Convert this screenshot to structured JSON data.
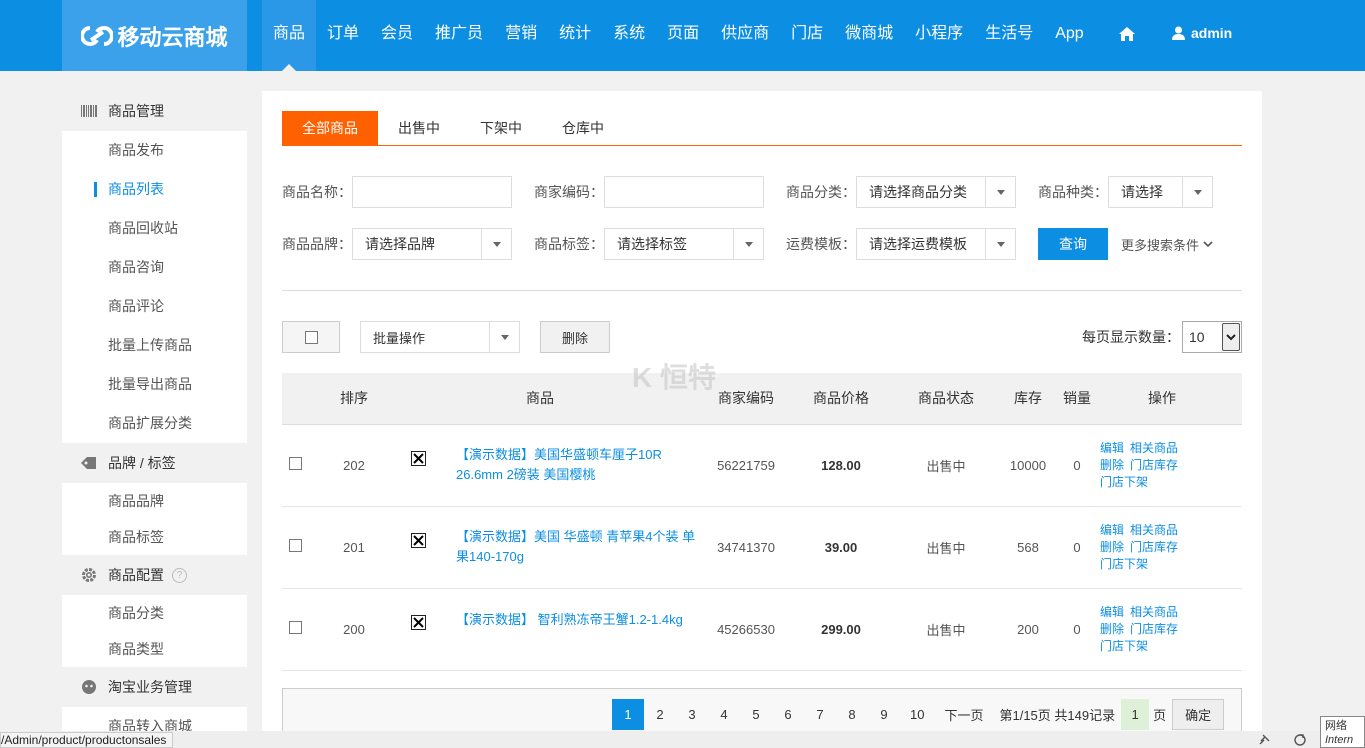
{
  "header": {
    "logo_text": "移动云商城",
    "nav": [
      "商品",
      "订单",
      "会员",
      "推广员",
      "营销",
      "统计",
      "系统",
      "页面",
      "供应商",
      "门店",
      "微商城",
      "小程序",
      "生活号",
      "App"
    ],
    "user": "admin"
  },
  "sidebar": {
    "groups": [
      {
        "title": "商品管理",
        "icon": "barcode-icon",
        "items": [
          "商品发布",
          "商品列表",
          "商品回收站",
          "商品咨询",
          "商品评论",
          "批量上传商品",
          "批量导出商品",
          "商品扩展分类"
        ]
      },
      {
        "title": "品牌 / 标签",
        "icon": "tag-icon",
        "items": [
          "商品品牌",
          "商品标签"
        ]
      },
      {
        "title": "商品配置",
        "icon": "gear-icon",
        "help": "?",
        "items": [
          "商品分类",
          "商品类型"
        ]
      },
      {
        "title": "淘宝业务管理",
        "icon": "taobao-icon",
        "items": [
          "商品转入商城"
        ]
      }
    ],
    "active_item": "商品列表"
  },
  "tabs": [
    "全部商品",
    "出售中",
    "下架中",
    "仓库中"
  ],
  "filters": {
    "name_label": "商品名称：",
    "code_label": "商家编码：",
    "category_label": "商品分类：",
    "category_value": "请选择商品分类",
    "type_label": "商品种类：",
    "type_value": "请选择",
    "brand_label": "商品品牌：",
    "brand_value": "请选择品牌",
    "tag_label": "商品标签：",
    "tag_value": "请选择标签",
    "freight_label": "运费模板：",
    "freight_value": "请选择运费模板",
    "search_button": "查询",
    "more_label": "更多搜索条件"
  },
  "batch": {
    "batch_select": "批量操作",
    "delete_button": "删除",
    "per_page_label": "每页显示数量：",
    "per_page_value": "10"
  },
  "table": {
    "headers": [
      "排序",
      "商品",
      "商家编码",
      "商品价格",
      "商品状态",
      "库存",
      "销量",
      "操作"
    ],
    "rows": [
      {
        "sort": "202",
        "name": "【演示数据】美国华盛顿车厘子10R 26.6mm 2磅装 美国樱桃",
        "code": "56221759",
        "price": "128.00",
        "status": "出售中",
        "stock": "10000",
        "sales": "0"
      },
      {
        "sort": "201",
        "name": "【演示数据】美国 华盛顿 青苹果4个装 单果140-170g",
        "code": "34741370",
        "price": "39.00",
        "status": "出售中",
        "stock": "568",
        "sales": "0"
      },
      {
        "sort": "200",
        "name": "【演示数据】 智利熟冻帝王蟹1.2-1.4kg",
        "code": "45266530",
        "price": "299.00",
        "status": "出售中",
        "stock": "200",
        "sales": "0"
      }
    ],
    "ops": {
      "edit": "编辑",
      "related": "相关商品",
      "delete": "删除",
      "store_stock": "门店库存",
      "store_off": "门店下架"
    }
  },
  "pager": {
    "pages": [
      "1",
      "2",
      "3",
      "4",
      "5",
      "6",
      "7",
      "8",
      "9",
      "10"
    ],
    "next": "下一页",
    "info": "第1/15页 共149记录",
    "input": "1",
    "unit": "页",
    "ok": "确定"
  },
  "watermark": "K 恒特",
  "statusbar": {
    "url": "/Admin/product/productonsales",
    "net": "网络",
    "net2": "Intern"
  },
  "colors": {
    "primary": "#0c8ee3",
    "accent": "#ff6000"
  }
}
